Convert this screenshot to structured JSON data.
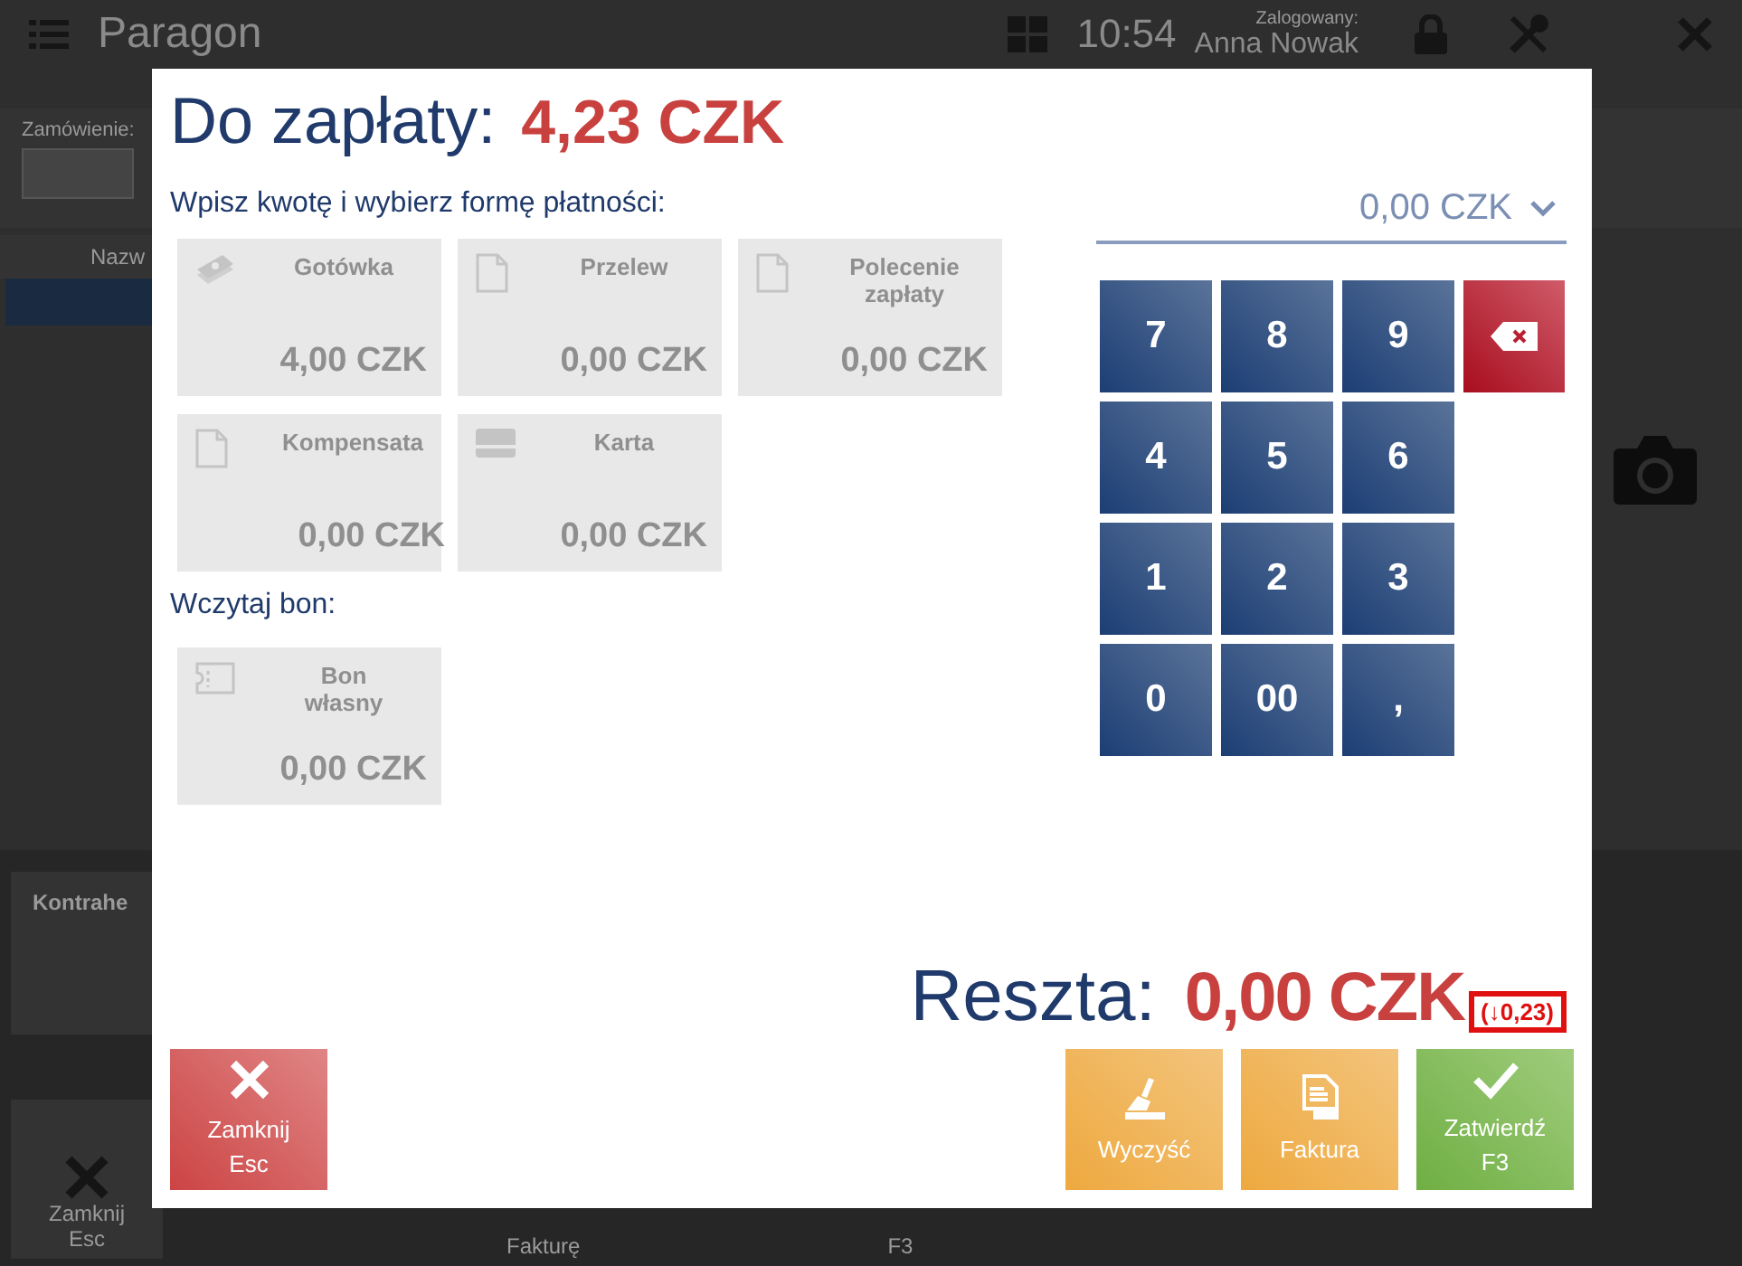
{
  "background": {
    "app_title": "Paragon",
    "time": "10:54",
    "user_label": "Zalogowany:",
    "user": "Anna Nowak",
    "order_label": "Zamówienie:",
    "column_1": "Nazw",
    "customer_label": "Kontrahe",
    "close_label": "Zamknij",
    "close_shortcut": "Esc",
    "invoice_label": "Fakturę",
    "confirm_shortcut": "F3"
  },
  "dialog": {
    "title": "Do zapłaty:",
    "amount_due": "4,23 CZK",
    "instruction": "Wpisz kwotę i wybierz formę płatności:",
    "methods": [
      {
        "name": "Gotówka",
        "amount": "4,00 CZK",
        "kind": "cash",
        "disabled": true
      },
      {
        "name": "Przelew",
        "amount": "0,00 CZK",
        "kind": "document",
        "disabled": true
      },
      {
        "name": "Polecenie zapłaty",
        "amount": "0,00 CZK",
        "kind": "document",
        "disabled": true
      },
      {
        "name": "Kompensata",
        "amount": "0,00 CZK",
        "kind": "document",
        "disabled": true
      },
      {
        "name": "Karta",
        "amount": "0,00 CZK",
        "kind": "card",
        "disabled": true
      }
    ],
    "voucher_label": "Wczytaj bon:",
    "vouchers": [
      {
        "name": "Bon własny",
        "amount": "0,00 CZK",
        "kind": "voucher",
        "disabled": true
      }
    ],
    "input": {
      "value": "0,00 CZK"
    },
    "keypad": [
      "7",
      "8",
      "9",
      "4",
      "5",
      "6",
      "1",
      "2",
      "3",
      "0",
      "00",
      ","
    ],
    "change_label": "Reszta:",
    "change": "0,00 CZK",
    "change_difference": "(↓0,23)",
    "buttons": [
      {
        "label": "Zamknij",
        "shortcut": "Esc",
        "kind": "close"
      },
      {
        "label": "Wyczyść",
        "kind": "clear"
      },
      {
        "label": "Faktura",
        "kind": "invoice"
      },
      {
        "label": "Zatwierdź",
        "shortcut": "F3",
        "kind": "confirm"
      }
    ]
  }
}
